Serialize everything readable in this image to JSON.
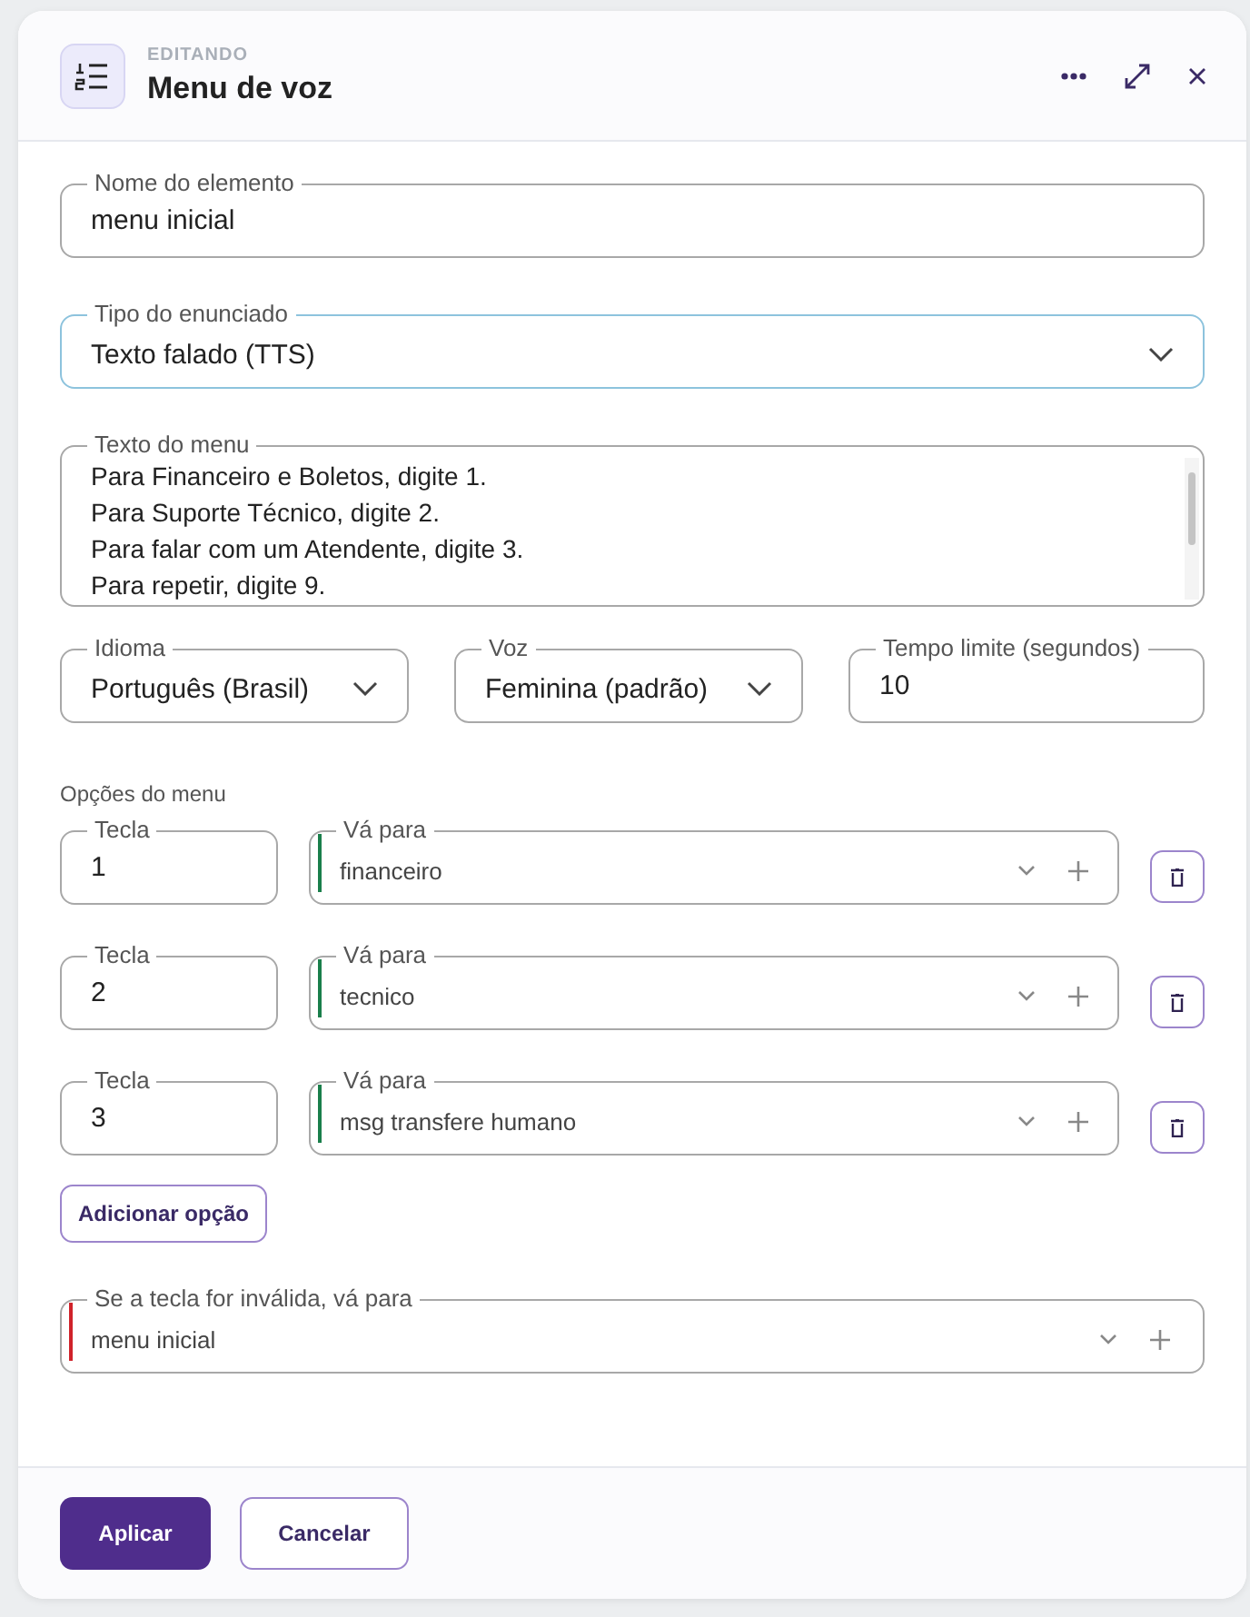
{
  "header": {
    "overline": "EDITANDO",
    "title": "Menu de voz"
  },
  "fields": {
    "name": {
      "label": "Nome do elemento",
      "value": "menu inicial"
    },
    "prompt_type": {
      "label": "Tipo do enunciado",
      "value": "Texto falado (TTS)"
    },
    "menu_text": {
      "label": "Texto do menu",
      "lines": [
        "Para Financeiro e Boletos, digite 1.",
        "Para Suporte Técnico, digite 2.",
        "Para falar com um Atendente, digite 3.",
        "Para repetir, digite 9."
      ]
    },
    "language": {
      "label": "Idioma",
      "value": "Português (Brasil)"
    },
    "voice": {
      "label": "Voz",
      "value": "Feminina (padrão)"
    },
    "timeout": {
      "label": "Tempo limite (segundos)",
      "value": "10"
    }
  },
  "options_title": "Opções do menu",
  "options": [
    {
      "key_label": "Tecla",
      "key": "1",
      "goto_label": "Vá para",
      "goto": "financeiro",
      "color": "#1a7f4b"
    },
    {
      "key_label": "Tecla",
      "key": "2",
      "goto_label": "Vá para",
      "goto": "tecnico",
      "color": "#1a7f4b"
    },
    {
      "key_label": "Tecla",
      "key": "3",
      "goto_label": "Vá para",
      "goto": "msg transfere humano",
      "color": "#1a7f4b"
    }
  ],
  "add_option": "Adicionar opção",
  "fallback": {
    "label": "Se a tecla for inválida, vá para",
    "value": "menu inicial",
    "color": "#d0222a"
  },
  "buttons": {
    "apply": "Aplicar",
    "cancel": "Cancelar"
  }
}
